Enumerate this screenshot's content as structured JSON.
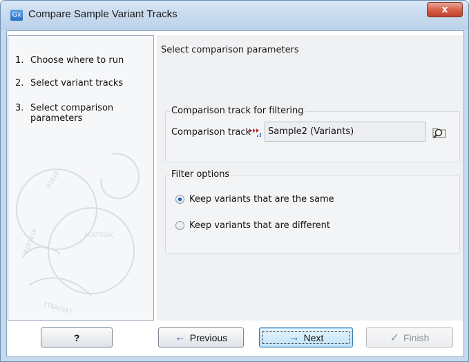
{
  "window": {
    "app_icon": "Gx",
    "title": "Compare Sample Variant Tracks",
    "close_glyph": "x"
  },
  "sidebar": {
    "steps": [
      {
        "number": "1.",
        "label": "Choose where to run"
      },
      {
        "number": "2.",
        "label": "Select variant tracks"
      },
      {
        "number": "3.",
        "label": "Select comparison\nparameters"
      }
    ]
  },
  "main": {
    "title": "Select comparison parameters",
    "comparison_group": {
      "title": "Comparison track for filtering",
      "field_label": "Comparison track",
      "value": "Sample2 (Variants)",
      "icons": [
        "variant-track-icon",
        "browse-icon"
      ]
    },
    "filter_group": {
      "title": "Filter options",
      "options": [
        {
          "label": "Keep variants that are the same",
          "checked": true
        },
        {
          "label": "Keep variants that are different",
          "checked": false
        }
      ]
    }
  },
  "footer": {
    "help_label": "?",
    "previous_label": "Previous",
    "next_label": "Next",
    "finish_label": "Finish"
  },
  "colors": {
    "accent": "#1d5fb3",
    "titlebar": "#c9dbee",
    "close": "#c2402a"
  }
}
